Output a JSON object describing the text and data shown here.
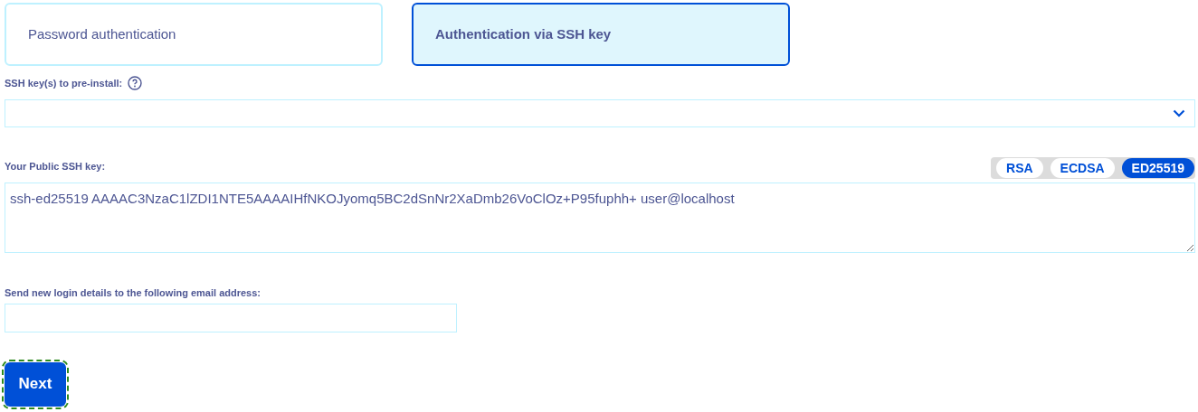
{
  "auth_tabs": [
    {
      "label": "Password authentication",
      "selected": false
    },
    {
      "label": "Authentication via SSH key",
      "selected": true
    }
  ],
  "ssh_keys_select": {
    "label": "SSH key(s) to pre-install:"
  },
  "public_key": {
    "label": "Your Public SSH key:",
    "value": "ssh-ed25519 AAAAC3NzaC1lZDI1NTE5AAAAIHfNKOJyomq5BC2dSnNr2XaDmb26VoClOz+P95fuphh+ user@localhost",
    "key_types": [
      {
        "label": "RSA",
        "selected": false
      },
      {
        "label": "ECDSA",
        "selected": false
      },
      {
        "label": "ED25519",
        "selected": true
      }
    ]
  },
  "email": {
    "label": "Send new login details to the following email address:"
  },
  "next_button": {
    "label": "Next",
    "focused": true
  }
}
